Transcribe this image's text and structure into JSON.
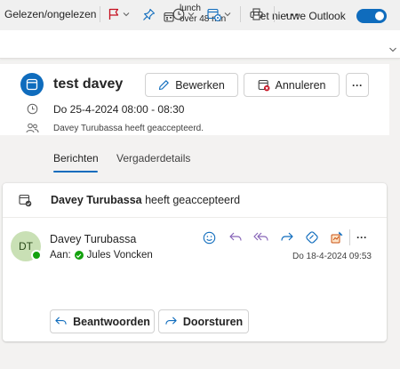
{
  "top_bar": {
    "reminder_title": "lunch",
    "reminder_time": "over 48 min",
    "new_outlook_label": "Het nieuwe Outlook",
    "new_outlook_toggle_on": true
  },
  "ribbon": {
    "read_unread_label": "Gelezen/ongelezen",
    "more_label": "···"
  },
  "event": {
    "title": "test davey",
    "edit_label": "Bewerken",
    "cancel_label": "Annuleren",
    "more_label": "···",
    "date_time": "Do 25-4-2024 08:00 - 08:30",
    "status": "Davey Turubassa heeft geaccepteerd."
  },
  "tabs": [
    {
      "label": "Berichten",
      "active": true
    },
    {
      "label": "Vergaderdetails",
      "active": false
    }
  ],
  "message": {
    "header_name": "Davey Turubassa",
    "header_rest": " heeft geaccepteerd",
    "avatar_initials": "DT",
    "sender": "Davey Turubassa",
    "to_label": "Aan:",
    "to_name": "Jules Voncken",
    "date": "Do 18-4-2024 09:53",
    "more_label": "···",
    "reply_label": "Beantwoorden",
    "forward_label": "Doorsturen"
  },
  "colors": {
    "accent": "#0f6cbd",
    "flag": "#c50f1f",
    "reply_purple": "#8764b8",
    "presence_green": "#13a10e",
    "avatar_bg": "#c9e0b5"
  }
}
